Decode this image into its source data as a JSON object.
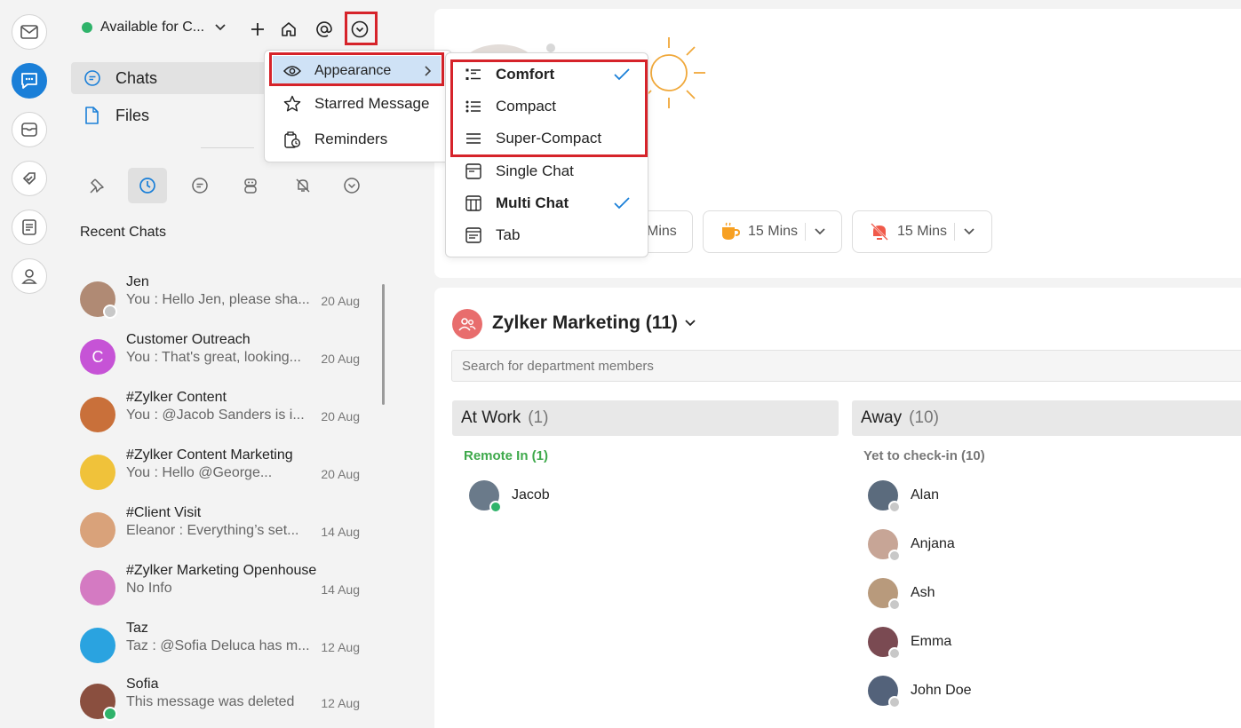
{
  "rail": {
    "items": [
      {
        "icon": "mail-icon"
      },
      {
        "icon": "chat-icon",
        "active": true
      },
      {
        "icon": "inbox-icon"
      },
      {
        "icon": "tasks-icon"
      },
      {
        "icon": "notes-icon"
      },
      {
        "icon": "contacts-icon"
      }
    ]
  },
  "header": {
    "status_label": "Available for C...",
    "status_color": "#2fb36a"
  },
  "nav": {
    "chats": "Chats",
    "files": "Files"
  },
  "recent_chats_label": "Recent Chats",
  "chats": [
    {
      "name": "Jen",
      "message": "You : Hello Jen, please sha...",
      "date": "20 Aug",
      "color": "#b08a74",
      "presence": "offline"
    },
    {
      "name": "Customer Outreach",
      "message": "You : That's great, looking...",
      "date": "20 Aug",
      "color": "#c653d6",
      "initial": "C"
    },
    {
      "name": "#Zylker Content",
      "message": "You : @Jacob Sanders  is i...",
      "date": "20 Aug",
      "color": "#c9703a"
    },
    {
      "name": "#Zylker Content Marketing",
      "message": "You : Hello @George...",
      "date": "20 Aug",
      "color": "#f0c23a"
    },
    {
      "name": "#Client Visit",
      "message": "Eleanor : Everything’s set...",
      "date": "14 Aug",
      "color": "#d9a27a"
    },
    {
      "name": "#Zylker Marketing Openhouse",
      "message": "No Info",
      "date": "14 Aug",
      "color": "#d47ac2"
    },
    {
      "name": "Taz",
      "message": "Taz : @Sofia Deluca has m...",
      "date": "12 Aug",
      "color": "#2aa3e0"
    },
    {
      "name": "Sofia",
      "message": "This message was deleted",
      "date": "12 Aug",
      "color": "#8a4f3f",
      "presence": "online"
    }
  ],
  "main_menu": {
    "items": [
      {
        "label": "Appearance",
        "icon": "eye-icon"
      },
      {
        "label": "Starred Message",
        "icon": "star-icon"
      },
      {
        "label": "Reminders",
        "icon": "reminder-icon"
      }
    ]
  },
  "appearance_menu": {
    "items": [
      {
        "label": "Comfort",
        "icon": "comfort-icon",
        "checked": true,
        "bold": true
      },
      {
        "label": "Compact",
        "icon": "compact-icon"
      },
      {
        "label": "Super-Compact",
        "icon": "super-compact-icon"
      },
      {
        "label": "Single Chat",
        "icon": "single-chat-icon"
      },
      {
        "label": "Multi Chat",
        "icon": "multi-chat-icon",
        "checked": true,
        "bold": true
      },
      {
        "label": "Tab",
        "icon": "tab-icon"
      }
    ]
  },
  "timers": [
    {
      "label": "Mins"
    },
    {
      "label": "15 Mins",
      "icon": "coffee-icon"
    },
    {
      "label": "15 Mins",
      "icon": "mute-bell-icon"
    }
  ],
  "department": {
    "title": "Zylker Marketing (11)",
    "search_placeholder": "Search for department members",
    "at_work": {
      "label": "At Work",
      "count": "(1)",
      "sub_label": "Remote In (1)",
      "sub_color": "#3ea94b",
      "members": [
        "Jacob"
      ]
    },
    "away": {
      "label": "Away",
      "count": "(10)",
      "sub_label": "Yet to check-in (10)",
      "members": [
        "Alan",
        "Anjana",
        "Ash",
        "Emma",
        "John Doe"
      ]
    }
  },
  "colors": {
    "accent": "#1a7fd8",
    "highlight_box": "#d6232a",
    "menu_selected": "#cfe2f6"
  }
}
